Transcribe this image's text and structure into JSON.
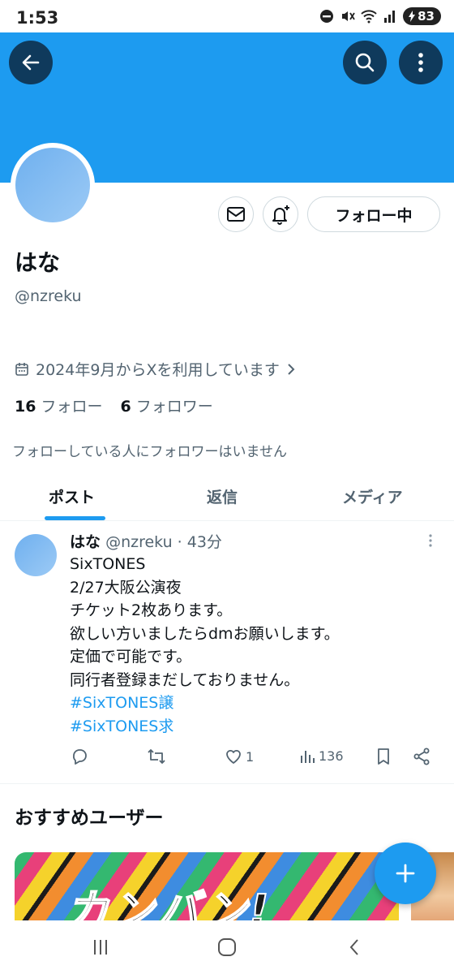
{
  "status_bar": {
    "time": "1:53",
    "battery": "83",
    "icons": [
      "do-not-disturb-icon",
      "mute-icon",
      "wifi-icon",
      "signal-icon",
      "battery-charging-icon"
    ]
  },
  "header": {
    "banner_color": "#1d9bf0",
    "buttons": [
      "back-arrow-icon",
      "search-icon",
      "more-vertical-icon"
    ]
  },
  "profile": {
    "display_name": "はな",
    "handle": "@nzreku",
    "joined": "2024年9月からXを利用しています",
    "following_count": "16",
    "following_label": "フォロー",
    "followers_count": "6",
    "followers_label": "フォロワー",
    "mutual_note": "フォローしている人にフォロワーはいません",
    "follow_button": "フォロー中"
  },
  "tabs": [
    {
      "label": "ポスト",
      "active": true
    },
    {
      "label": "返信",
      "active": false
    },
    {
      "label": "メディア",
      "active": false
    }
  ],
  "tweet": {
    "name": "はな",
    "meta": "@nzreku · 43分",
    "lines": [
      "SixTONES",
      "2/27大阪公演夜",
      "チケット2枚あります。",
      "欲しい方いましたらdmお願いします。",
      "定価で可能です。",
      "同行者登録まだしておりません。"
    ],
    "hashtags": [
      "#SixTONES譲",
      "#SixTONES求"
    ],
    "likes": "1",
    "views": "136"
  },
  "recommendations": {
    "title": "おすすめユーザー",
    "card_text": "カンバン!"
  },
  "colors": {
    "accent": "#1d9bf0",
    "text": "#0f1419",
    "muted": "#536471",
    "border": "#cfd9de"
  }
}
